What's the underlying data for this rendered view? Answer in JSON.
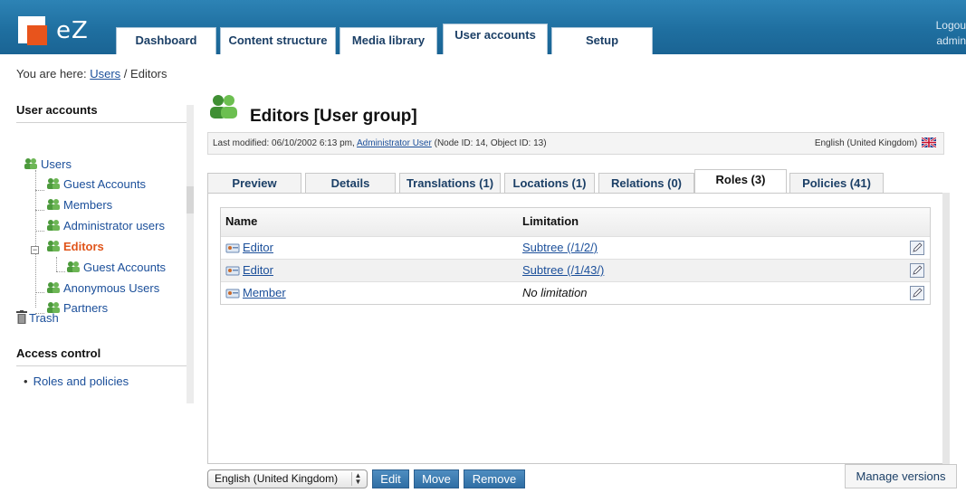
{
  "header": {
    "logo_text": "eZ",
    "tabs": [
      {
        "label": "Dashboard"
      },
      {
        "label": "Content structure"
      },
      {
        "label": "Media library"
      },
      {
        "label": "User accounts"
      },
      {
        "label": "Setup"
      }
    ],
    "active_tab": "User accounts",
    "logout_label": "Logou",
    "user_label": "admin"
  },
  "breadcrumb": {
    "prefix": "You are here:",
    "link": "Users",
    "separator": "/",
    "current": "Editors"
  },
  "sidebar": {
    "title": "User accounts",
    "tree": [
      {
        "label": "Users"
      },
      {
        "label": "Guest Accounts"
      },
      {
        "label": "Members"
      },
      {
        "label": "Administrator users"
      },
      {
        "label": "Editors"
      },
      {
        "label": "Guest Accounts"
      },
      {
        "label": "Anonymous Users"
      },
      {
        "label": "Partners"
      }
    ],
    "trash_label": "Trash",
    "access_title": "Access control",
    "access_items": [
      {
        "label": "Roles and policies"
      }
    ]
  },
  "object": {
    "title": "Editors [User group]",
    "meta_prefix": "Last modified: 06/10/2002 6:13 pm,",
    "meta_author": "Administrator User",
    "meta_suffix": "(Node ID: 14, Object ID: 13)",
    "language": "English (United Kingdom)"
  },
  "subtabs": [
    {
      "label": "Preview"
    },
    {
      "label": "Details"
    },
    {
      "label": "Translations (1)"
    },
    {
      "label": "Locations (1)"
    },
    {
      "label": "Relations (0)"
    },
    {
      "label": "Roles (3)"
    },
    {
      "label": "Policies (41)"
    }
  ],
  "active_subtab": "Roles (3)",
  "roles_table": {
    "columns": [
      "Name",
      "Limitation"
    ],
    "rows": [
      {
        "name": "Editor",
        "limitation": "Subtree (/1/2/)"
      },
      {
        "name": "Editor",
        "limitation": "Subtree (/1/43/)"
      },
      {
        "name": "Member",
        "limitation": "No limitation"
      }
    ]
  },
  "bottom": {
    "language_select": "English (United Kingdom)",
    "edit_label": "Edit",
    "move_label": "Move",
    "remove_label": "Remove",
    "manage_versions_label": "Manage versions"
  },
  "colors": {
    "header_blue": "#1f6fa0",
    "link_blue": "#1b4f9a",
    "current_orange": "#e0551b",
    "button_blue": "#2f6ea4"
  },
  "icons": {
    "user_group": "user-group-icon",
    "trash": "trash-icon",
    "role": "role-icon",
    "edit": "edit-pencil-icon",
    "flag": "uk-flag-icon"
  }
}
